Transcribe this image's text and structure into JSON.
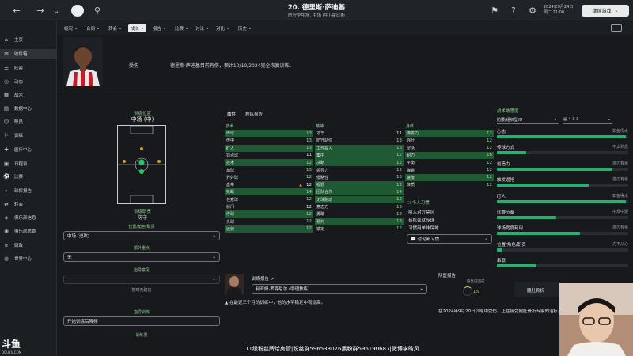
{
  "topbar": {
    "title": "20. 德里斯·萨迪基",
    "subtitle": "防守型中场, 中场 (中)-霍比斯",
    "date_line1": "2024年9月24日",
    "date_line2": "周二 21:00",
    "continue_label": "继续游戏"
  },
  "sidebar": {
    "items": [
      {
        "label": "主页",
        "icon": "home-icon"
      },
      {
        "label": "收件箱",
        "icon": "inbox-icon",
        "active": true
      },
      {
        "label": "阵容",
        "icon": "squad-icon"
      },
      {
        "label": "动态",
        "icon": "dynamics-icon"
      },
      {
        "label": "战术",
        "icon": "tactics-icon"
      },
      {
        "label": "数据中心",
        "icon": "data-icon"
      },
      {
        "label": "职员",
        "icon": "staff-icon"
      },
      {
        "label": "训练",
        "icon": "training-icon"
      },
      {
        "label": "医疗中心",
        "icon": "medical-icon"
      },
      {
        "label": "日程表",
        "icon": "calendar-icon"
      },
      {
        "label": "比赛",
        "icon": "match-icon"
      },
      {
        "label": "球探报告",
        "icon": "scouting-icon"
      },
      {
        "label": "转会",
        "icon": "transfer-icon"
      },
      {
        "label": "俱乐部信息",
        "icon": "club-info-icon"
      },
      {
        "label": "俱乐部愿景",
        "icon": "club-vision-icon"
      },
      {
        "label": "财政",
        "icon": "finance-icon"
      },
      {
        "label": "世界中心",
        "icon": "world-icon"
      }
    ]
  },
  "tabs": [
    {
      "label": "概况"
    },
    {
      "label": "合同"
    },
    {
      "label": "转会"
    },
    {
      "label": "成长",
      "active": true
    },
    {
      "label": "报告"
    },
    {
      "label": "比赛"
    },
    {
      "label": "讨论"
    },
    {
      "label": "对比"
    },
    {
      "label": "历史"
    }
  ],
  "header": {
    "injury_label": "受伤",
    "injury_text": "德里斯·萨迪基目前有伤，预计10/10/2024完全恢复训练。"
  },
  "position": {
    "label": "训练位置",
    "value": "中场 (中)",
    "role_label": "训练职责",
    "role_value": "防守",
    "pos_role_label": "位置/角色/职责",
    "pos_role_value": "中场 (进攻)",
    "extra_label": "额外重点",
    "extra_value": "无",
    "advice_label": "指导意见",
    "advice_value": "",
    "advice_note": "暂时无建议",
    "dash": "-",
    "training_label": "指导训练",
    "training_value": "开始训练后降频",
    "load_label": "训练量"
  },
  "attr_tabs": [
    {
      "label": "属性",
      "active": true
    },
    {
      "label": "教练报告"
    }
  ],
  "attributes": {
    "technical": {
      "head": "技术",
      "rows": [
        {
          "name": "传球",
          "value": 13,
          "tone": "g",
          "hl": true
        },
        {
          "name": "传中",
          "value": 13,
          "tone": "g"
        },
        {
          "name": "盯人",
          "value": 13,
          "tone": "g",
          "hl": true
        },
        {
          "name": "罚点球",
          "value": 11,
          "tone": "w"
        },
        {
          "name": "技术",
          "value": 12,
          "tone": "g",
          "hl": true
        },
        {
          "name": "角球",
          "value": 13,
          "tone": "g"
        },
        {
          "name": "界外球",
          "value": 12,
          "tone": "g"
        },
        {
          "name": "盘带",
          "value": 12,
          "tone": "w",
          "warn": "▲"
        },
        {
          "name": "抢断",
          "value": 14,
          "tone": "g",
          "hl": true
        },
        {
          "name": "任意球",
          "value": 12,
          "tone": "g"
        },
        {
          "name": "射门",
          "value": 12,
          "tone": "w"
        },
        {
          "name": "停球",
          "value": 12,
          "tone": "g",
          "hl": true
        },
        {
          "name": "头球",
          "value": 12,
          "tone": "g"
        },
        {
          "name": "远射",
          "value": 12,
          "tone": "g",
          "hl": true
        }
      ]
    },
    "mental": {
      "head": "精神",
      "rows": [
        {
          "name": "才华",
          "value": 11,
          "tone": "w"
        },
        {
          "name": "防守站位",
          "value": 13,
          "tone": "g"
        },
        {
          "name": "工作投入",
          "value": 16,
          "tone": "g",
          "hl": true
        },
        {
          "name": "集中",
          "value": 12,
          "tone": "g",
          "hl": true
        },
        {
          "name": "决断",
          "value": 12,
          "tone": "g",
          "hl": true
        },
        {
          "name": "领导力",
          "value": 12,
          "tone": "g"
        },
        {
          "name": "侵略性",
          "value": 13,
          "tone": "g"
        },
        {
          "name": "视野",
          "value": 12,
          "tone": "g",
          "hl": true
        },
        {
          "name": "团队合作",
          "value": 14,
          "tone": "g",
          "hl": true
        },
        {
          "name": "无球跑动",
          "value": 12,
          "tone": "g",
          "hl": true
        },
        {
          "name": "意志力",
          "value": 13,
          "tone": "g"
        },
        {
          "name": "勇敢",
          "value": 12,
          "tone": "g"
        },
        {
          "name": "预判",
          "value": 13,
          "tone": "g",
          "hl": true
        },
        {
          "name": "镇定",
          "value": 12,
          "tone": "g"
        }
      ]
    },
    "physical": {
      "head": "身体",
      "rows": [
        {
          "name": "爆发力",
          "value": 12,
          "tone": "g",
          "hl": true
        },
        {
          "name": "强壮",
          "value": 12,
          "tone": "g"
        },
        {
          "name": "灵活",
          "value": 12,
          "tone": "g"
        },
        {
          "name": "耐力",
          "value": 16,
          "tone": "g",
          "hl": true
        },
        {
          "name": "平衡",
          "value": 12,
          "tone": "g"
        },
        {
          "name": "弹跳",
          "value": 12,
          "tone": "g"
        },
        {
          "name": "速度",
          "value": 12,
          "tone": "g",
          "hl": true
        },
        {
          "name": "体质",
          "value": 12,
          "tone": "g"
        }
      ]
    }
  },
  "habits": {
    "head": "个人习惯",
    "items": [
      "插入对方禁区",
      "有机会就传球",
      "习惯用单抹保地"
    ],
    "discuss_label": "讨论新习惯"
  },
  "training_report": {
    "link": "训练报告 >",
    "coach": "利亚姆·罗森尼尔 (助理教练)",
    "note": "在最近三个月的训练中，他的水平稳定中有提高。"
  },
  "team_report": {
    "head": "队医报告",
    "recovery_label": "恢复已完成",
    "recovery_pct": "1%",
    "note": "在2024年9月20日训练中受伤。正在接受腿肚骨折专家的治疗。"
  },
  "tactical": {
    "title": "战术熟悉度",
    "role_select": "防腰/组织型/D",
    "formation": "4-3-3",
    "rows": [
      {
        "label": "心态",
        "status": "如鱼得水",
        "level": 0.98
      },
      {
        "label": "传球方式",
        "status": "不太熟悉",
        "level": 0.22
      },
      {
        "label": "创造力",
        "status": "游刃有余",
        "level": 0.88
      },
      {
        "label": "触发逼抢",
        "status": "游刃有余",
        "level": 0.7
      },
      {
        "label": "盯人",
        "status": "如鱼得水",
        "level": 0.98
      },
      {
        "label": "比赛节奏",
        "status": "中规中矩",
        "level": 0.45
      },
      {
        "label": "球场宽度利用",
        "status": "游刃有余",
        "level": 0.63
      },
      {
        "label": "位置/角色/职责",
        "status": "力不从心",
        "level": 0.04
      },
      {
        "label": "串联",
        "status": "",
        "level": 0.3
      }
    ]
  },
  "overlay": {
    "bruise": "腿肚骨折",
    "banner": "11级粉丝牌给房管|粉丝群596533076黑粉群596190687|微博李晗风",
    "logo": "斗鱼",
    "logo_sub": "DOUYU.COM"
  },
  "colors": {
    "highlight_row": "#1f5a35",
    "fill_green": "#28b073",
    "label_green": "#8fd08f"
  }
}
